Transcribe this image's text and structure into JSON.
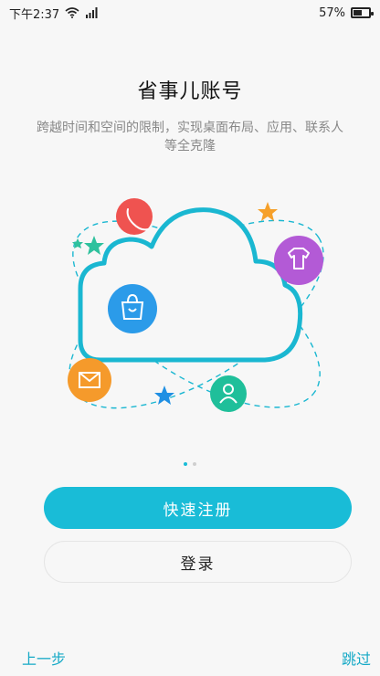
{
  "status_bar": {
    "time": "下午2:37",
    "battery_text": "57%",
    "battery_level": 0.57
  },
  "title": "省事儿账号",
  "description": "跨越时间和空间的限制，实现桌面布局、应用、联系人等全克隆",
  "pager": {
    "count": 2,
    "active": 0
  },
  "buttons": {
    "register": "快速注册",
    "login": "登录"
  },
  "footer": {
    "prev": "上一步",
    "skip": "跳过"
  },
  "colors": {
    "accent": "#19bcd7",
    "cloud": "#1ab7d1",
    "phone": "#ef5350",
    "shirt": "#b35ad6",
    "bag": "#2b9be9",
    "mail": "#f59a2b",
    "person": "#1fbf9a",
    "star_orange": "#f6a02a",
    "star_green": "#2fc19d",
    "star_blue": "#1f8fe3"
  },
  "icons": [
    "phone-icon",
    "shirt-icon",
    "shopping-bag-icon",
    "mail-icon",
    "person-icon",
    "star-icon"
  ]
}
